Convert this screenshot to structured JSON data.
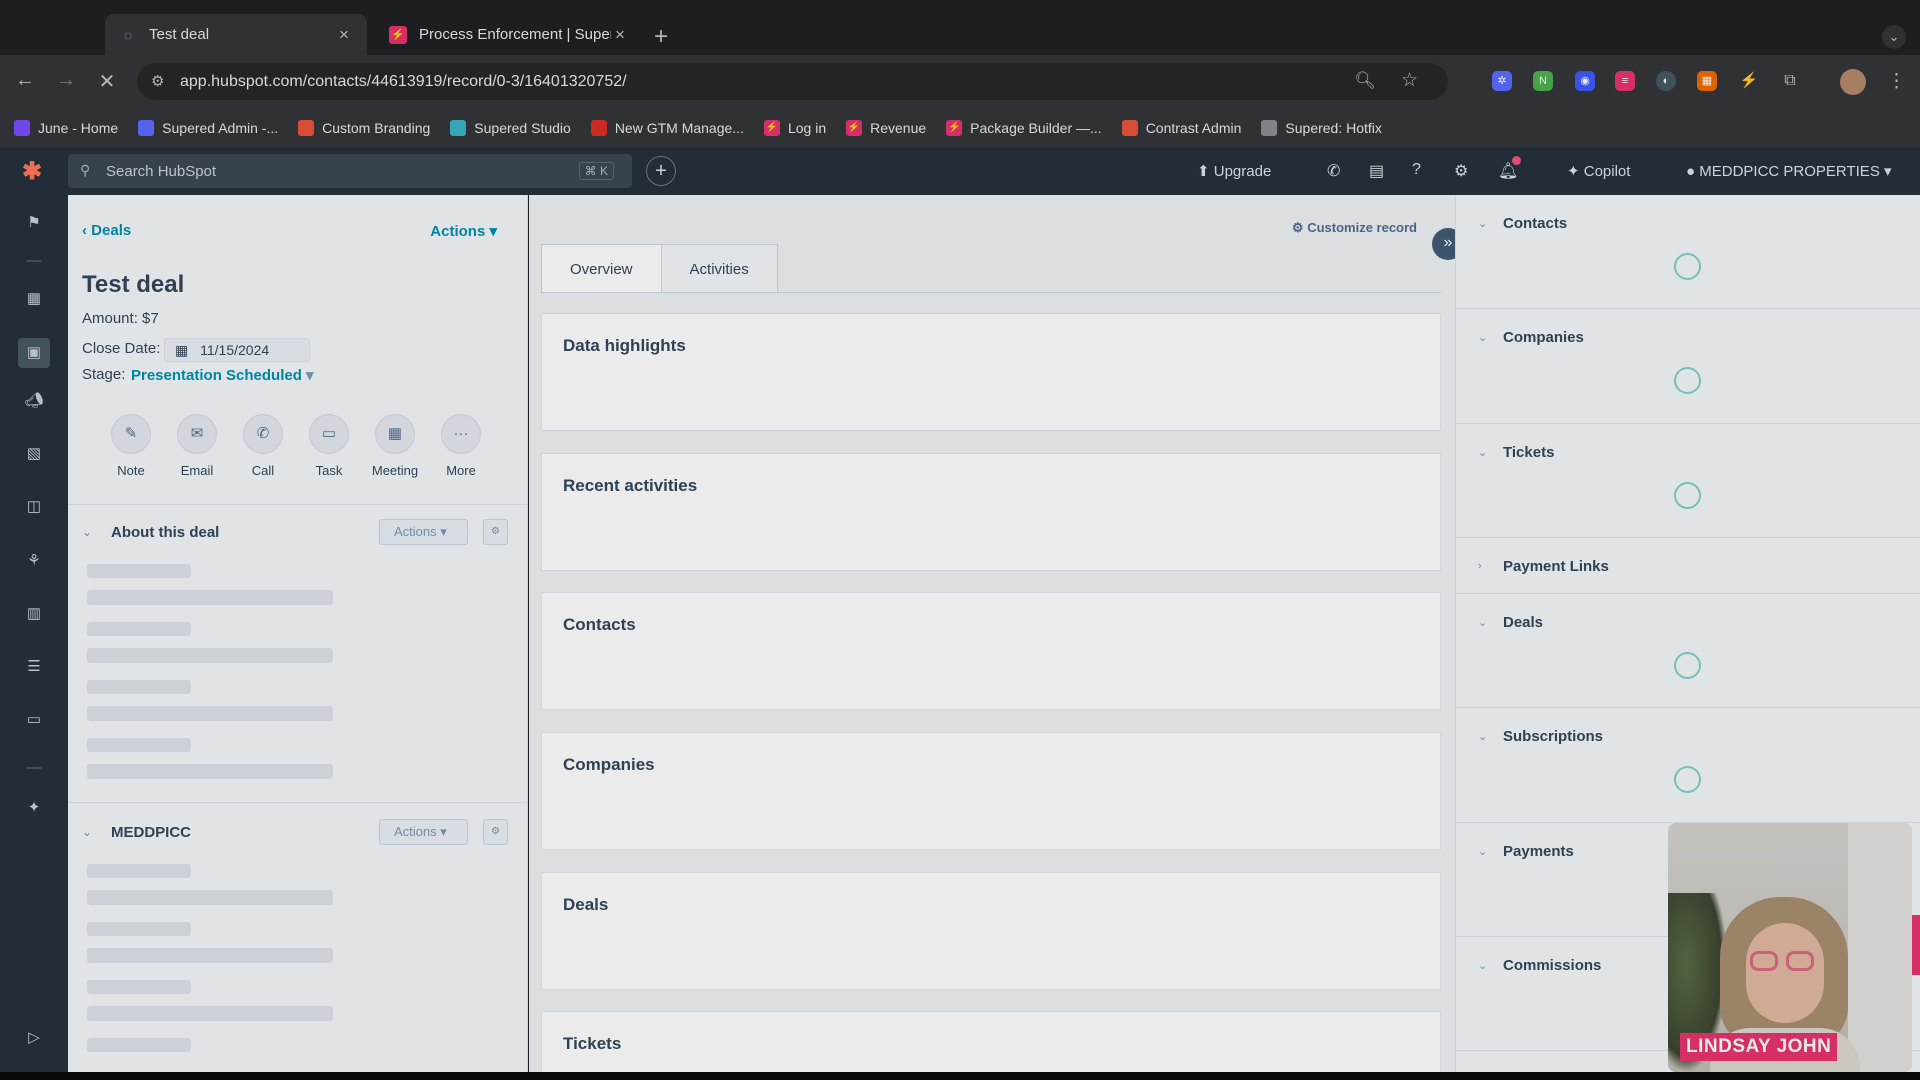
{
  "browser": {
    "tabs": [
      {
        "title": "Test deal",
        "active": true
      },
      {
        "title": "Process Enforcement | Super",
        "active": false
      }
    ],
    "url": "app.hubspot.com/contacts/44613919/record/0-3/16401320752/",
    "bookmarks": [
      {
        "label": "June - Home",
        "icon": "june-icon",
        "color": "#7c4dff"
      },
      {
        "label": "Supered Admin -...",
        "icon": "supered-icon",
        "color": "#5b6cff"
      },
      {
        "label": "Custom Branding",
        "icon": "branding-icon",
        "color": "#e8543b"
      },
      {
        "label": "Supered Studio",
        "icon": "studio-icon",
        "color": "#3bb5c9"
      },
      {
        "label": "New GTM Manage...",
        "icon": "gmail-icon",
        "color": "#d93025"
      },
      {
        "label": "Log in",
        "icon": "lightning-icon",
        "color": "#e8336f"
      },
      {
        "label": "Revenue",
        "icon": "lightning-icon",
        "color": "#e8336f"
      },
      {
        "label": "Package Builder —...",
        "icon": "lightning-icon",
        "color": "#e8336f"
      },
      {
        "label": "Contrast Admin",
        "icon": "contrast-icon",
        "color": "#e8543b"
      },
      {
        "label": "Supered: Hotfix",
        "icon": "globe-icon",
        "color": "#8a8f96"
      }
    ]
  },
  "hubspot": {
    "search_placeholder": "Search HubSpot",
    "search_shortcut": "⌘ K",
    "upgrade_label": "Upgrade",
    "copilot_label": "Copilot",
    "account_label": "MEDDPICC PROPERTIES"
  },
  "left": {
    "breadcrumb": "Deals",
    "actions_label": "Actions",
    "deal_name": "Test deal",
    "amount": "Amount: $7",
    "close_date_label": "Close Date:",
    "close_date": "11/15/2024",
    "stage_label": "Stage:",
    "stage_value": "Presentation Scheduled",
    "quick_actions": [
      "Note",
      "Email",
      "Call",
      "Task",
      "Meeting",
      "More"
    ],
    "cards": [
      {
        "title": "About this deal",
        "actions_label": "Actions"
      },
      {
        "title": "MEDDPICC",
        "actions_label": "Actions"
      }
    ]
  },
  "middle": {
    "customize_label": "Customize record",
    "tabs": [
      "Overview",
      "Activities"
    ],
    "cards": [
      "Data highlights",
      "Recent activities",
      "Contacts",
      "Companies",
      "Deals",
      "Tickets"
    ]
  },
  "right": {
    "sections": [
      {
        "title": "Contacts",
        "expanded": true,
        "loading": true
      },
      {
        "title": "Companies",
        "expanded": true,
        "loading": true
      },
      {
        "title": "Tickets",
        "expanded": true,
        "loading": true
      },
      {
        "title": "Payment Links",
        "expanded": false,
        "loading": false
      },
      {
        "title": "Deals",
        "expanded": true,
        "loading": true
      },
      {
        "title": "Subscriptions",
        "expanded": true,
        "loading": true
      },
      {
        "title": "Payments",
        "expanded": true,
        "loading": false
      },
      {
        "title": "Commissions",
        "expanded": true,
        "loading": false
      }
    ]
  },
  "webcam": {
    "name": "LINDSAY JOHN"
  }
}
